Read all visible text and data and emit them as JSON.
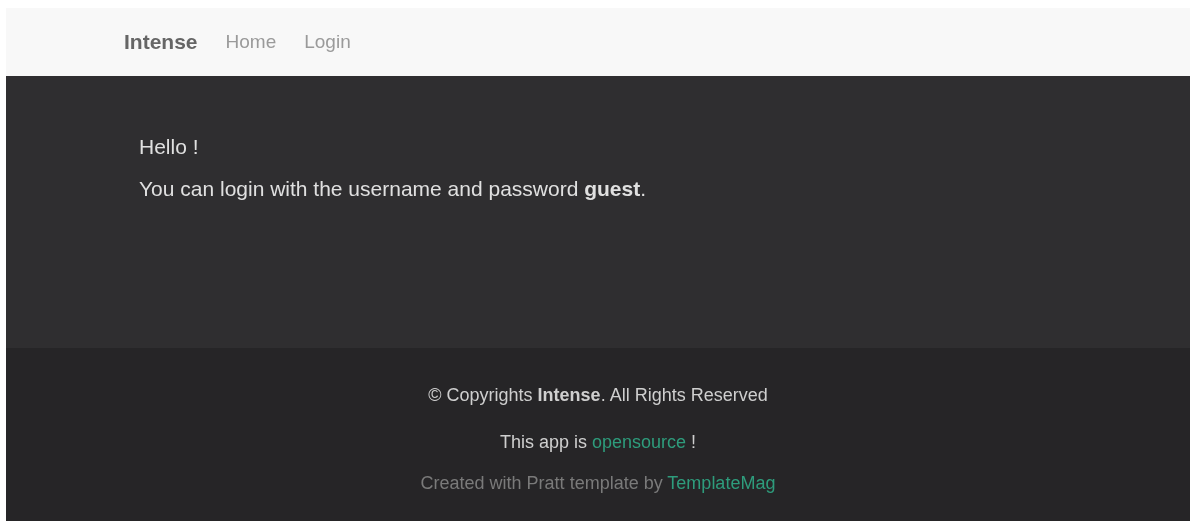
{
  "navbar": {
    "brand": "Intense",
    "links": [
      {
        "label": "Home"
      },
      {
        "label": "Login"
      }
    ]
  },
  "content": {
    "lines": [
      "Hello !",
      "You can login with the username and password **guest**."
    ]
  },
  "footer": {
    "copyright": "© Copyrights **Intense**. All Rights Reserved",
    "lines": [
      {
        "before": "This app is ",
        "link": "opensource",
        "after": " !",
        "kind": "bright"
      },
      {
        "before": "Created with Pratt template by ",
        "link": "TemplateMag",
        "kind": "dim"
      }
    ]
  }
}
